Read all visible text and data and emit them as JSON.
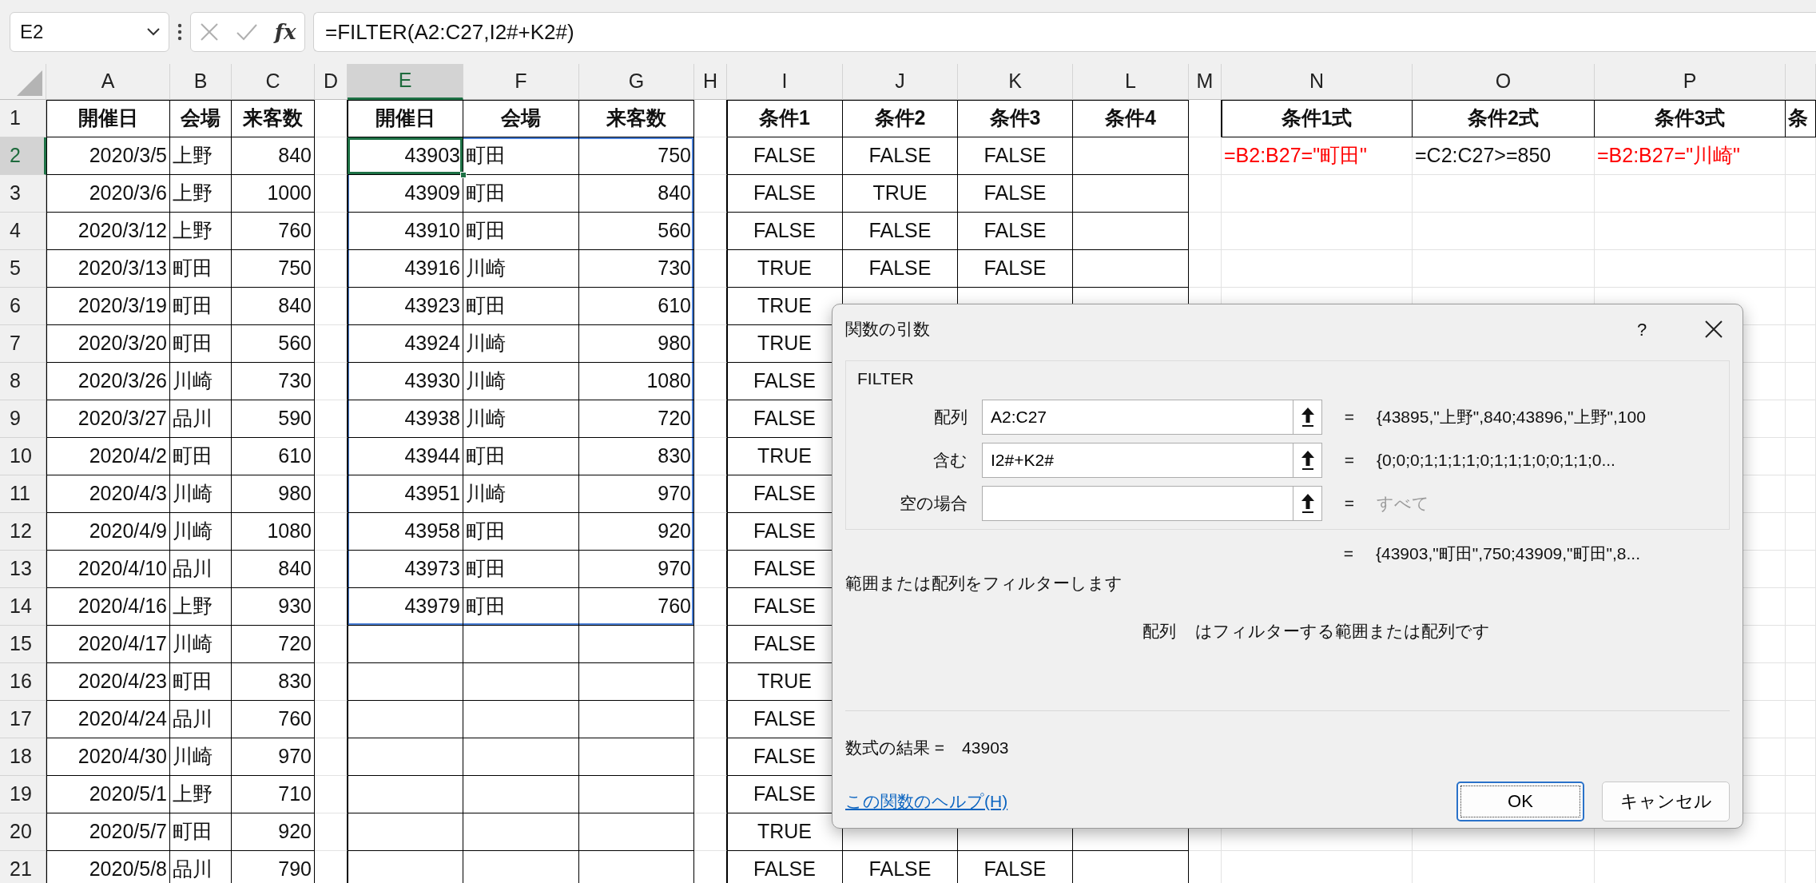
{
  "formula_bar": {
    "name_box": "E2",
    "fx_label": "fx",
    "formula": "=FILTER(A2:C27,I2#+K2#)"
  },
  "column_headers": [
    {
      "label": "A",
      "selected": false
    },
    {
      "label": "B",
      "selected": false
    },
    {
      "label": "C",
      "selected": false
    },
    {
      "label": "D",
      "selected": false
    },
    {
      "label": "E",
      "selected": true
    },
    {
      "label": "F",
      "selected": false
    },
    {
      "label": "G",
      "selected": false
    },
    {
      "label": "H",
      "selected": false
    },
    {
      "label": "I",
      "selected": false
    },
    {
      "label": "J",
      "selected": false
    },
    {
      "label": "K",
      "selected": false
    },
    {
      "label": "L",
      "selected": false
    },
    {
      "label": "M",
      "selected": false
    },
    {
      "label": "N",
      "selected": false
    },
    {
      "label": "O",
      "selected": false
    },
    {
      "label": "P",
      "selected": false
    }
  ],
  "rows": [
    {
      "number": "1",
      "selected": false,
      "spill": false,
      "cells": [
        "開催日",
        "会場",
        "来客数",
        null,
        "開催日",
        "会場",
        "来客数",
        null,
        "条件1",
        "条件2",
        "条件3",
        "条件4",
        null,
        "条件1式",
        "条件2式",
        "条件3式",
        "条"
      ]
    },
    {
      "number": "2",
      "selected": true,
      "spill": true,
      "cells": [
        "2020/3/5",
        "上野",
        "840",
        null,
        "43903",
        "町田",
        "750",
        null,
        "FALSE",
        "FALSE",
        "FALSE",
        null,
        null,
        {
          "text": "=B2:B27=\"町田\"",
          "color": "#ff0000"
        },
        "=C2:C27>=850",
        {
          "text": "=B2:B27=\"川崎\"",
          "color": "#ff0000"
        },
        null
      ]
    },
    {
      "number": "3",
      "selected": false,
      "spill": true,
      "cells": [
        "2020/3/6",
        "上野",
        "1000",
        null,
        "43909",
        "町田",
        "840",
        null,
        "FALSE",
        "TRUE",
        "FALSE"
      ]
    },
    {
      "number": "4",
      "selected": false,
      "spill": true,
      "cells": [
        "2020/3/12",
        "上野",
        "760",
        null,
        "43910",
        "町田",
        "560",
        null,
        "FALSE",
        "FALSE",
        "FALSE"
      ]
    },
    {
      "number": "5",
      "selected": false,
      "spill": true,
      "cells": [
        "2020/3/13",
        "町田",
        "750",
        null,
        "43916",
        "川崎",
        "730",
        null,
        "TRUE",
        "FALSE",
        "FALSE"
      ]
    },
    {
      "number": "6",
      "selected": false,
      "spill": true,
      "cells": [
        "2020/3/19",
        "町田",
        "840",
        null,
        "43923",
        "町田",
        "610",
        null,
        "TRUE"
      ]
    },
    {
      "number": "7",
      "selected": false,
      "spill": true,
      "cells": [
        "2020/3/20",
        "町田",
        "560",
        null,
        "43924",
        "川崎",
        "980",
        null,
        "TRUE"
      ]
    },
    {
      "number": "8",
      "selected": false,
      "spill": true,
      "cells": [
        "2020/3/26",
        "川崎",
        "730",
        null,
        "43930",
        "川崎",
        "1080",
        null,
        "FALSE"
      ]
    },
    {
      "number": "9",
      "selected": false,
      "spill": true,
      "cells": [
        "2020/3/27",
        "品川",
        "590",
        null,
        "43938",
        "川崎",
        "720",
        null,
        "FALSE"
      ]
    },
    {
      "number": "10",
      "selected": false,
      "spill": true,
      "cells": [
        "2020/4/2",
        "町田",
        "610",
        null,
        "43944",
        "町田",
        "830",
        null,
        "TRUE"
      ]
    },
    {
      "number": "11",
      "selected": false,
      "spill": true,
      "cells": [
        "2020/4/3",
        "川崎",
        "980",
        null,
        "43951",
        "川崎",
        "970",
        null,
        "FALSE"
      ]
    },
    {
      "number": "12",
      "selected": false,
      "spill": true,
      "cells": [
        "2020/4/9",
        "川崎",
        "1080",
        null,
        "43958",
        "町田",
        "920",
        null,
        "FALSE"
      ]
    },
    {
      "number": "13",
      "selected": false,
      "spill": true,
      "cells": [
        "2020/4/10",
        "品川",
        "840",
        null,
        "43973",
        "町田",
        "970",
        null,
        "FALSE"
      ]
    },
    {
      "number": "14",
      "selected": false,
      "spill": true,
      "cells": [
        "2020/4/16",
        "上野",
        "930",
        null,
        "43979",
        "町田",
        "760",
        null,
        "FALSE"
      ]
    },
    {
      "number": "15",
      "selected": false,
      "spill": false,
      "cells": [
        "2020/4/17",
        "川崎",
        "720",
        null,
        null,
        null,
        null,
        null,
        "FALSE"
      ]
    },
    {
      "number": "16",
      "selected": false,
      "spill": false,
      "cells": [
        "2020/4/23",
        "町田",
        "830",
        null,
        null,
        null,
        null,
        null,
        "TRUE"
      ]
    },
    {
      "number": "17",
      "selected": false,
      "spill": false,
      "cells": [
        "2020/4/24",
        "品川",
        "760",
        null,
        null,
        null,
        null,
        null,
        "FALSE"
      ]
    },
    {
      "number": "18",
      "selected": false,
      "spill": false,
      "cells": [
        "2020/4/30",
        "川崎",
        "970",
        null,
        null,
        null,
        null,
        null,
        "FALSE"
      ]
    },
    {
      "number": "19",
      "selected": false,
      "spill": false,
      "cells": [
        "2020/5/1",
        "上野",
        "710",
        null,
        null,
        null,
        null,
        null,
        "FALSE"
      ]
    },
    {
      "number": "20",
      "selected": false,
      "spill": false,
      "cells": [
        "2020/5/7",
        "町田",
        "920",
        null,
        null,
        null,
        null,
        null,
        "TRUE"
      ]
    },
    {
      "number": "21",
      "selected": false,
      "spill": false,
      "cells": [
        "2020/5/8",
        "品川",
        "790",
        null,
        null,
        null,
        null,
        null,
        "FALSE",
        "FALSE",
        "FALSE"
      ]
    }
  ],
  "dialog": {
    "title": "関数の引数",
    "help_button": "?",
    "function_name": "FILTER",
    "arguments": [
      {
        "label": "配列",
        "value": "A2:C27",
        "eq": "=",
        "result": "{43895,\"上野\",840;43896,\"上野\",100",
        "muted": false
      },
      {
        "label": "含む",
        "value": "I2#+K2#",
        "eq": "=",
        "result": "{0;0;0;1;1;1;1;0;1;1;1;0;0;1;1;0...",
        "muted": false
      },
      {
        "label": "空の場合",
        "eq": "=",
        "result": "すべて",
        "muted": true
      }
    ],
    "overall": {
      "eq": "=",
      "value": "{43903,\"町田\",750;43909,\"町田\",8..."
    },
    "description": "範囲または配列をフィルターします",
    "argument_help": {
      "name": "配列",
      "text": "はフィルターする範囲または配列です"
    },
    "formula_result": {
      "label": "数式の結果 =",
      "value": "43903"
    },
    "help_link": "この関数のヘルプ(H)",
    "buttons": [
      {
        "label": "OK",
        "focused": true
      },
      {
        "label": "キャンセル",
        "focused": false
      }
    ]
  }
}
